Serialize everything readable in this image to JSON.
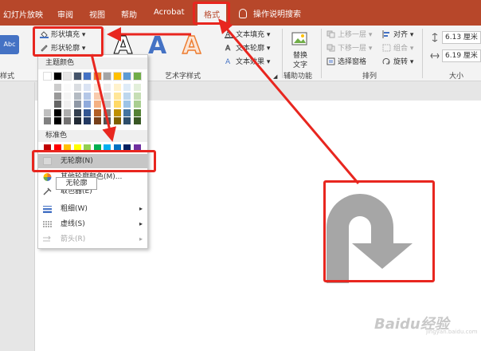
{
  "tabs": [
    {
      "label": "幻灯片放映",
      "active": false
    },
    {
      "label": "审阅",
      "active": false
    },
    {
      "label": "视图",
      "active": false
    },
    {
      "label": "帮助",
      "active": false
    },
    {
      "label": "Acrobat",
      "active": false
    },
    {
      "label": "格式",
      "active": true
    }
  ],
  "tell_me": "操作说明搜索",
  "ribbon": {
    "shape_styles_label": "样式",
    "abc_label": "Abc",
    "shape_fill": "形状填充",
    "shape_outline": "形状轮廓",
    "wordart_label": "艺术字样式",
    "wordart_letter": "A",
    "text_fill": "文本填充",
    "text_outline": "文本轮廓",
    "text_effects": "文本效果",
    "accessibility_label": "辅助功能",
    "replace_text": "替换",
    "replace_text_2": "文字",
    "arrange_label": "排列",
    "bring_forward": "上移一层",
    "send_backward": "下移一层",
    "selection_pane": "选择窗格",
    "align": "对齐",
    "group": "组合",
    "rotate": "旋转",
    "size_label": "大小",
    "height": "6.13 厘米",
    "width": "6.19 厘米"
  },
  "dropdown": {
    "theme_colors": "主题颜色",
    "standard_colors": "标准色",
    "no_outline": "无轮廓(N)",
    "more_colors": "其他轮廓颜色(M)...",
    "eyedropper": "取色器(E)",
    "weight": "粗细(W)",
    "dashes": "虚线(S)",
    "arrows": "箭头(R)"
  },
  "tooltip": "无轮廓",
  "watermark": "Baidu经验",
  "watermark_sub": "jingyan.baidu.com",
  "colors": {
    "accent": "#b7472a",
    "annotation": "#e8261f",
    "shape": "#a6a6a6",
    "theme_row": [
      "#ffffff",
      "#000000",
      "#e7e6e6",
      "#44546a",
      "#4472c4",
      "#ed7d31",
      "#a5a5a5",
      "#ffc000",
      "#5b9bd5",
      "#70ad47"
    ],
    "standard": [
      "#c00000",
      "#ff0000",
      "#ffc000",
      "#ffff00",
      "#92d050",
      "#00b050",
      "#00b0f0",
      "#0070c0",
      "#002060",
      "#7030a0"
    ]
  }
}
